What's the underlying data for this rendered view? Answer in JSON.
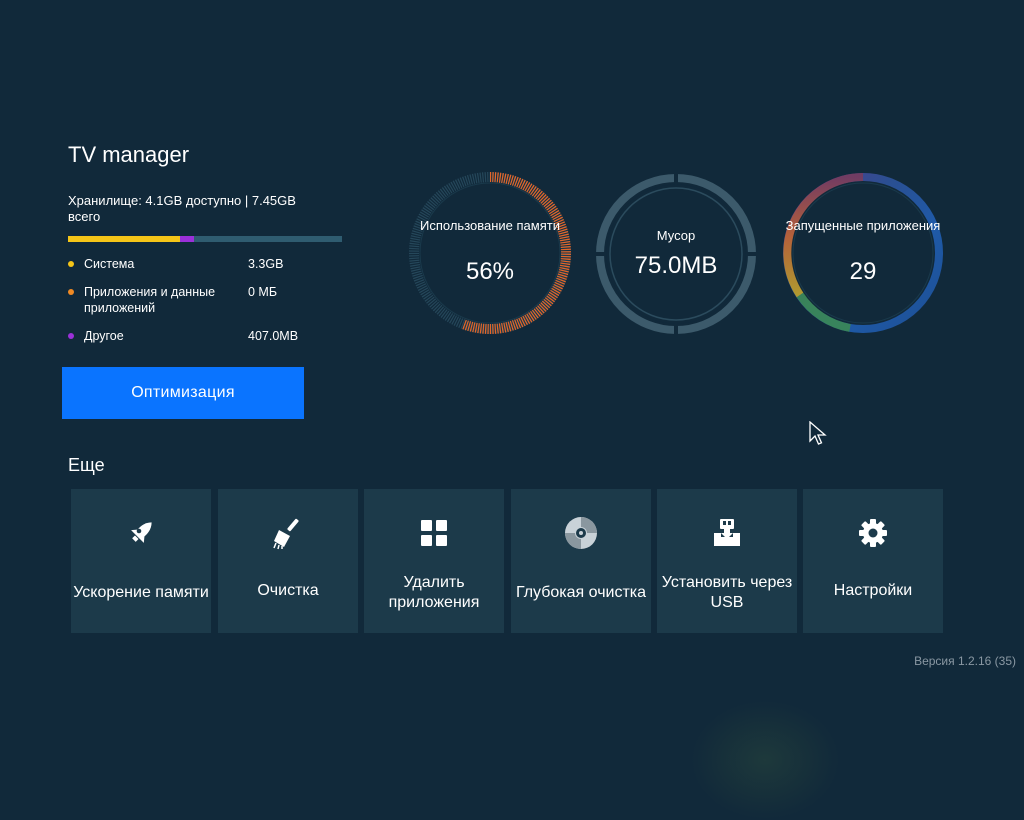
{
  "app_title": "TV manager",
  "storage": {
    "summary": "Хранилище: 4.1GB доступно | 7.45GB всего",
    "bar": [
      {
        "name": "Система",
        "fraction": 0.41,
        "color": "#f5c518"
      },
      {
        "name": "Приложения и данные приложений",
        "fraction": 0.0,
        "color": "#f08a24"
      },
      {
        "name": "Другое",
        "fraction": 0.05,
        "color": "#9b30d9"
      }
    ],
    "bar_track_color": "#2f5c70",
    "legend": [
      {
        "label": "Система",
        "value": "3.3GB",
        "color": "#f5c518"
      },
      {
        "label": "Приложения и данные приложений",
        "value": "0 МБ",
        "color": "#f08a24"
      },
      {
        "label": "Другое",
        "value": "407.0MB",
        "color": "#9b30d9"
      }
    ]
  },
  "optimize_button": "Оптимизация",
  "gauges": {
    "memory": {
      "label": "Использование памяти",
      "value": "56%",
      "fraction": 0.56,
      "color": "#e3662a"
    },
    "junk": {
      "label": "Мусор",
      "value": "75.0MB"
    },
    "running": {
      "label": "Запущенные приложения",
      "value": "29"
    }
  },
  "more_title": "Еще",
  "tiles": [
    {
      "icon": "rocket-icon",
      "label": "Ускорение памяти"
    },
    {
      "icon": "broom-icon",
      "label": "Очистка"
    },
    {
      "icon": "grid-icon",
      "label": "Удалить приложения"
    },
    {
      "icon": "disc-icon",
      "label": "Глубокая очистка"
    },
    {
      "icon": "usb-install-icon",
      "label": "Установить через USB"
    },
    {
      "icon": "gear-icon",
      "label": "Настройки"
    }
  ],
  "version": "Версия 1.2.16 (35)"
}
